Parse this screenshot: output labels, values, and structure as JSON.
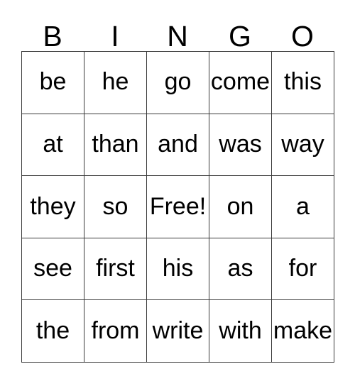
{
  "card": {
    "title": "BINGO",
    "header_letters": [
      "B",
      "I",
      "N",
      "G",
      "O"
    ],
    "free_space_label": "Free!",
    "free_space_position": {
      "row": 2,
      "col": 2
    },
    "grid_size": "5x5",
    "colors": {
      "background": "#ffffff",
      "text": "#000000",
      "border": "#3b3b3b"
    },
    "rows": [
      {
        "cells": [
          "be",
          "he",
          "go",
          "come",
          "this"
        ]
      },
      {
        "cells": [
          "at",
          "than",
          "and",
          "was",
          "way"
        ]
      },
      {
        "cells": [
          "they",
          "so",
          "Free!",
          "on",
          "a"
        ]
      },
      {
        "cells": [
          "see",
          "first",
          "his",
          "as",
          "for"
        ]
      },
      {
        "cells": [
          "the",
          "from",
          "write",
          "with",
          "make"
        ]
      }
    ]
  }
}
